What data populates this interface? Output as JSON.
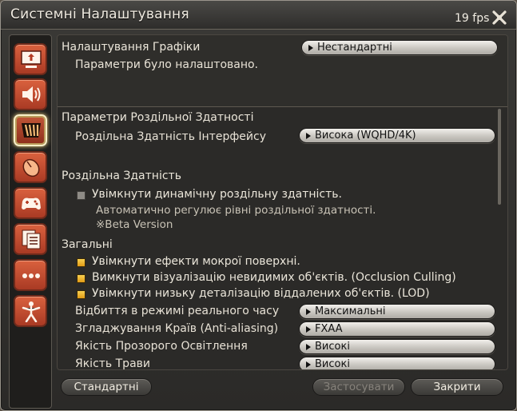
{
  "window": {
    "title": "Системні Налаштування",
    "fps": "19 fps"
  },
  "sidebar": {
    "items": [
      {
        "icon": "display-icon"
      },
      {
        "icon": "speaker-icon"
      },
      {
        "icon": "graphics-icon",
        "active": true
      },
      {
        "icon": "mouse-icon"
      },
      {
        "icon": "gamepad-icon"
      },
      {
        "icon": "document-icon"
      },
      {
        "icon": "more-icon"
      },
      {
        "icon": "character-icon"
      }
    ]
  },
  "graphics": {
    "label": "Налаштування Графіки",
    "preset": "Нестандартні",
    "status": "Параметри було налаштовано."
  },
  "resolution_params": {
    "heading": "Параметри Роздільної Здатності",
    "ui_resolution_label": "Роздільна Здатність Інтерфейсу",
    "ui_resolution_value": "Висока (WQHD/4K)"
  },
  "resolution": {
    "heading": "Роздільна Здатність",
    "dynamic_label": "Увімкнути динамічну роздільну здатність.",
    "dynamic_checked": false,
    "note_1": "Автоматично регулює рівні роздільної здатності.",
    "note_2": "※Beta Version"
  },
  "general": {
    "heading": "Загальні",
    "checkboxes": [
      {
        "label": "Увімкнути ефекти мокрої поверхні.",
        "checked": true
      },
      {
        "label": "Вимкнути візуалізацію невидимих об'єктів. (Occlusion Culling)",
        "checked": true
      },
      {
        "label": "Увімкнути низьку деталізацію віддалених об'єктів. (LOD)",
        "checked": true
      }
    ],
    "settings": [
      {
        "label": "Відбиття в режимі реального часу",
        "value": "Максимальні"
      },
      {
        "label": "Згладжування Країв (Anti-aliasing)",
        "value": "FXAA"
      },
      {
        "label": "Якість Прозорого Освітлення",
        "value": "Високі"
      },
      {
        "label": "Якість Трави",
        "value": "Високі"
      }
    ]
  },
  "footer": {
    "default_label": "Стандартні",
    "apply_label": "Застосувати",
    "close_label": "Закрити"
  }
}
